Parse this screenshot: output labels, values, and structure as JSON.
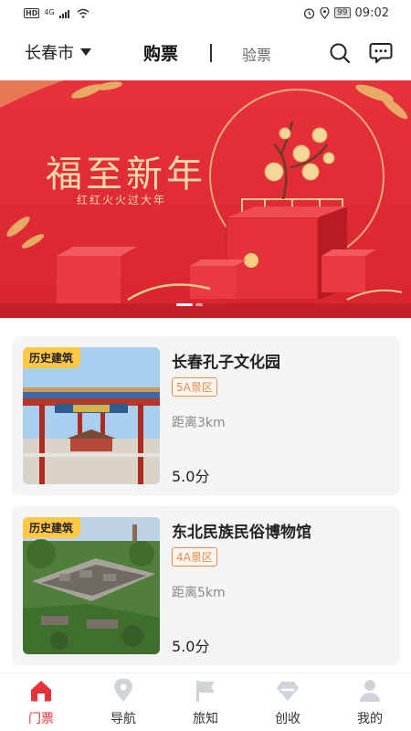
{
  "status_bar": {
    "left_badge": "HD",
    "network": "4G",
    "alarm_icon": "alarm-icon",
    "location_icon": "location-icon",
    "battery": "99",
    "time": "09:02"
  },
  "header": {
    "city": "长春市",
    "tab_buy": "购票",
    "tab_check": "验票",
    "search_icon": "search-icon",
    "message_icon": "message-icon"
  },
  "banner": {
    "title": "福至新年",
    "subtitle": "红红火火过大年",
    "slide_count": 2,
    "active_slide": 1,
    "colors": {
      "background": "#e2303a",
      "gold": "#f7d9a8"
    }
  },
  "attractions": [
    {
      "tag": "历史建筑",
      "name": "长春孔子文化园",
      "level": "5A景区",
      "distance": "距离3km",
      "score": "5.0分",
      "image_icon": "confucius-gate-photo"
    },
    {
      "tag": "历史建筑",
      "name": "东北民族民俗博物馆",
      "level": "4A景区",
      "distance": "距离5km",
      "score": "5.0分",
      "image_icon": "museum-aerial-photo"
    }
  ],
  "tabs": [
    {
      "label": "门票",
      "icon": "home-icon",
      "active": true
    },
    {
      "label": "导航",
      "icon": "location-pin-icon",
      "active": false
    },
    {
      "label": "旅知",
      "icon": "flag-icon",
      "active": false
    },
    {
      "label": "创收",
      "icon": "diamond-icon",
      "active": false
    },
    {
      "label": "我的",
      "icon": "person-icon",
      "active": false
    }
  ],
  "colors": {
    "accent": "#e8323c",
    "tag_yellow": "#ffc845",
    "level_orange": "#e8894a",
    "card_bg": "#f5f5f7",
    "inactive_icon": "#cfd3da"
  }
}
